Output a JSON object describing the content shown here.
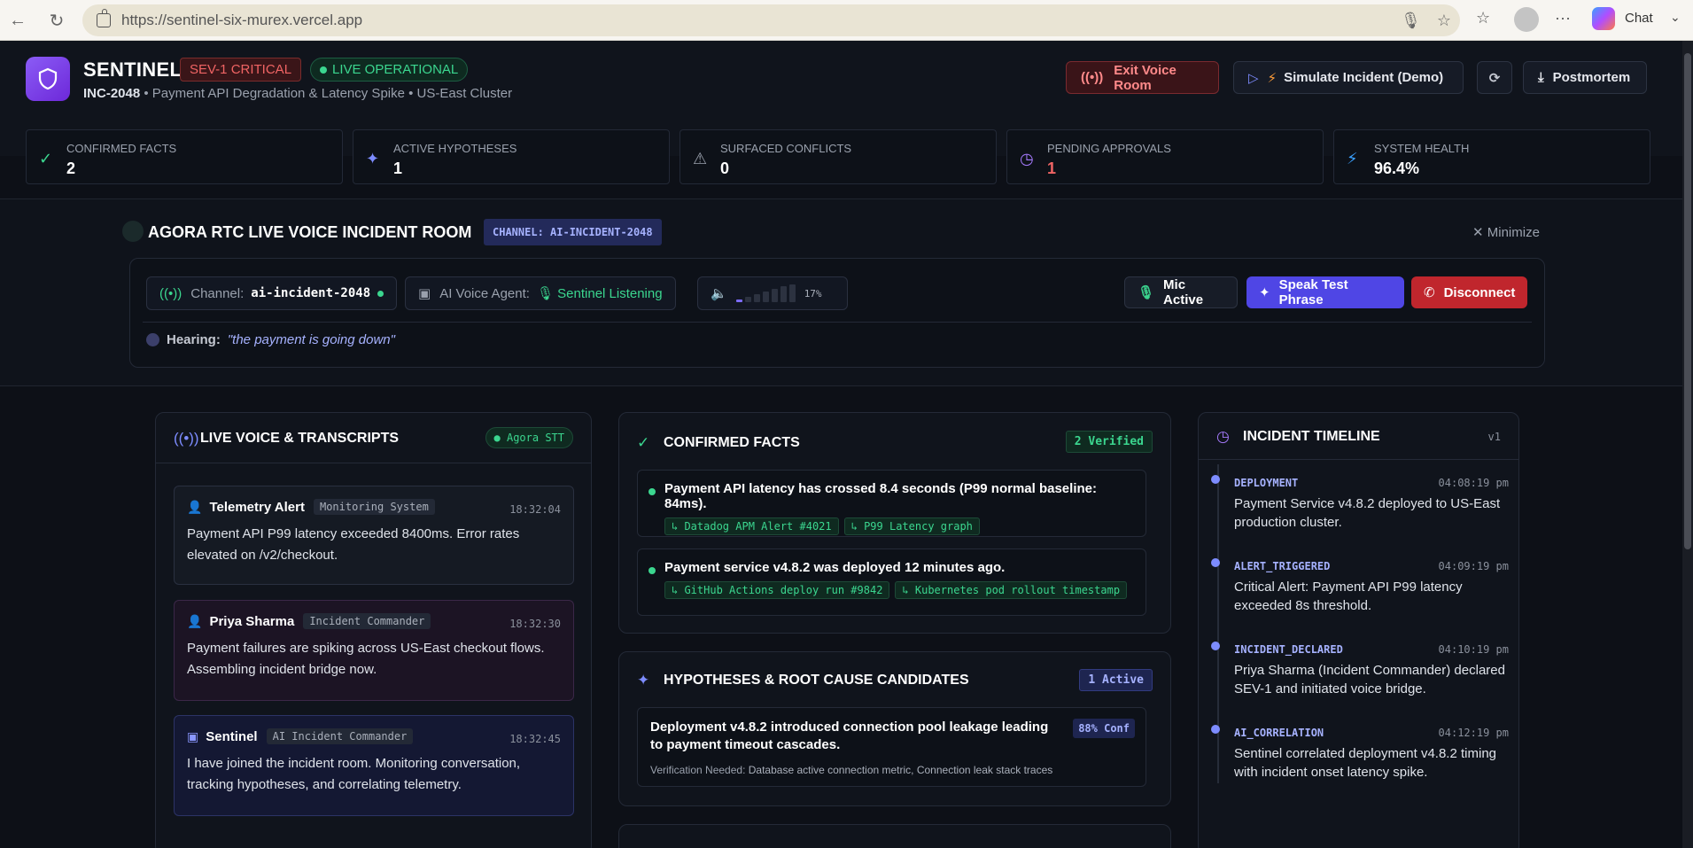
{
  "browser": {
    "url": "https://sentinel-six-murex.vercel.app",
    "chat_label": "Chat"
  },
  "header": {
    "brand": "SENTINEL",
    "severity": "SEV-1 CRITICAL",
    "live": "LIVE OPERATIONAL",
    "incident_id": "INC-2048",
    "incident_desc": " • Payment API Degradation & Latency Spike • US-East Cluster",
    "exit_voice": "Exit Voice Room",
    "simulate": "Simulate Incident (Demo)",
    "postmortem": "Postmortem"
  },
  "stats": [
    {
      "label": "Confirmed Facts",
      "value": "2",
      "icon": "check-circle-icon",
      "color": "#3bd68f"
    },
    {
      "label": "Active Hypotheses",
      "value": "1",
      "icon": "sparkle-icon",
      "color": "#7d8cff"
    },
    {
      "label": "Surfaced Conflicts",
      "value": "0",
      "icon": "warning-icon",
      "color": "#9aa1ad"
    },
    {
      "label": "Pending Approvals",
      "value": "1",
      "icon": "clock-icon",
      "color": "#a77bff"
    },
    {
      "label": "System Health",
      "value": "96.4%",
      "icon": "bolt-icon",
      "color": "#3aa0ff"
    }
  ],
  "voice_room": {
    "title": "AGORA RTC LIVE VOICE INCIDENT ROOM",
    "channel_badge": "CHANNEL: AI-INCIDENT-2048",
    "minimize": "Minimize",
    "channel_label": "Channel:",
    "channel_name": "ai-incident-2048",
    "agent_label": "AI Voice Agent:",
    "agent_status": "Sentinel Listening",
    "volume_pct": "17%",
    "mic": "Mic Active",
    "speak": "Speak Test Phrase",
    "disconnect": "Disconnect",
    "hearing_label": "Hearing:",
    "hearing_text": "\"the payment is going down\""
  },
  "transcripts": {
    "title": "LIVE VOICE & TRANSCRIPTS",
    "badge": "Agora STT",
    "items": [
      {
        "name": "Telemetry Alert",
        "role": "Monitoring System",
        "time": "18:32:04",
        "msg": "Payment API P99 latency exceeded 8400ms. Error rates elevated on /v2/checkout."
      },
      {
        "name": "Priya Sharma",
        "role": "Incident Commander",
        "time": "18:32:30",
        "msg": "Payment failures are spiking across US-East checkout flows. Assembling incident bridge now."
      },
      {
        "name": "Sentinel",
        "role": "AI Incident Commander",
        "time": "18:32:45",
        "msg": "I have joined the incident room. Monitoring conversation, tracking hypotheses, and correlating telemetry."
      }
    ]
  },
  "facts": {
    "title": "CONFIRMED FACTS",
    "badge": "2 Verified",
    "items": [
      {
        "text": "Payment API latency has crossed 8.4 seconds (P99 normal baseline: 84ms).",
        "tags": [
          "↳ Datadog APM Alert #4021",
          "↳ P99 Latency graph"
        ]
      },
      {
        "text": "Payment service v4.8.2 was deployed 12 minutes ago.",
        "tags": [
          "↳ GitHub Actions deploy run #9842",
          "↳ Kubernetes pod rollout timestamp"
        ]
      }
    ]
  },
  "hypotheses": {
    "title": "HYPOTHESES & ROOT CAUSE CANDIDATES",
    "badge": "1 Active",
    "text": "Deployment v4.8.2 introduced connection pool leakage leading to payment timeout cascades.",
    "conf": "88% Conf",
    "verify_label": "Verification Needed:",
    "verify_text": "Database active connection metric, Connection leak stack traces"
  },
  "timeline": {
    "title": "INCIDENT TIMELINE",
    "version": "v1",
    "items": [
      {
        "type": "DEPLOYMENT",
        "time": "04:08:19 pm",
        "desc": "Payment Service v4.8.2 deployed to US-East production cluster."
      },
      {
        "type": "ALERT_TRIGGERED",
        "time": "04:09:19 pm",
        "desc": "Critical Alert: Payment API P99 latency exceeded 8s threshold."
      },
      {
        "type": "INCIDENT_DECLARED",
        "time": "04:10:19 pm",
        "desc": "Priya Sharma (Incident Commander) declared SEV-1 and initiated voice bridge."
      },
      {
        "type": "AI_CORRELATION",
        "time": "04:12:19 pm",
        "desc": "Sentinel correlated deployment v4.8.2 timing with incident onset latency spike."
      }
    ]
  }
}
